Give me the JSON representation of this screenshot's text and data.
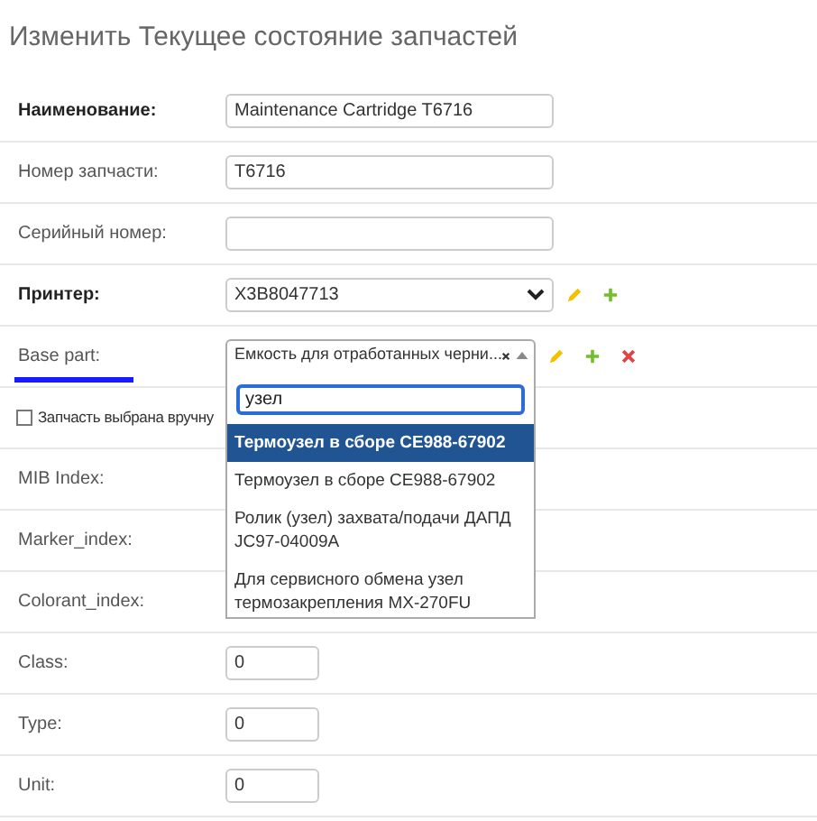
{
  "title": "Изменить Текущее состояние запчастей",
  "fields": [
    {
      "kind": "text",
      "label": "Наименование:",
      "required": true,
      "value": "Maintenance Cartridge T6716"
    },
    {
      "kind": "text",
      "label": "Номер запчасти:",
      "required": false,
      "value": "T6716"
    },
    {
      "kind": "text",
      "label": "Серийный номер:",
      "required": false
    },
    {
      "kind": "select",
      "label": "Принтер:",
      "required": true,
      "value": "X3B8047713",
      "actions": [
        {
          "kind": "edit"
        },
        {
          "kind": "add"
        }
      ]
    },
    {
      "kind": "autocomplete",
      "label": "Base part:",
      "required": false,
      "underlined": true,
      "value": "Емкость для отработанных черни...",
      "actions": [
        {
          "kind": "edit"
        },
        {
          "kind": "add"
        },
        {
          "kind": "delete"
        }
      ],
      "dropdown": {
        "search": "узел",
        "options": [
          {
            "label": "Термоузел в сборе CE988-67902",
            "selected": true
          },
          {
            "label": "Термоузел в сборе CE988-67902",
            "selected": false
          },
          {
            "label": "Ролик (узел) захвата/подачи ДАПД JC97-04009A",
            "selected": false
          },
          {
            "label": "Для сервисного обмена узел термозакрепления MX-270FU",
            "selected": false
          }
        ]
      }
    },
    {
      "kind": "checkbox",
      "label": "Запчасть выбрана вручну",
      "checked": false
    },
    {
      "kind": "hidden",
      "label": "MIB Index:",
      "required": false
    },
    {
      "kind": "hidden",
      "label": "Marker_index:",
      "required": false
    },
    {
      "kind": "hidden",
      "label": "Colorant_index:",
      "required": false
    },
    {
      "kind": "number",
      "label": "Class:",
      "required": false,
      "value": "0"
    },
    {
      "kind": "number",
      "label": "Type:",
      "required": false,
      "value": "0"
    },
    {
      "kind": "number",
      "label": "Unit:",
      "required": false,
      "value": "0"
    }
  ]
}
